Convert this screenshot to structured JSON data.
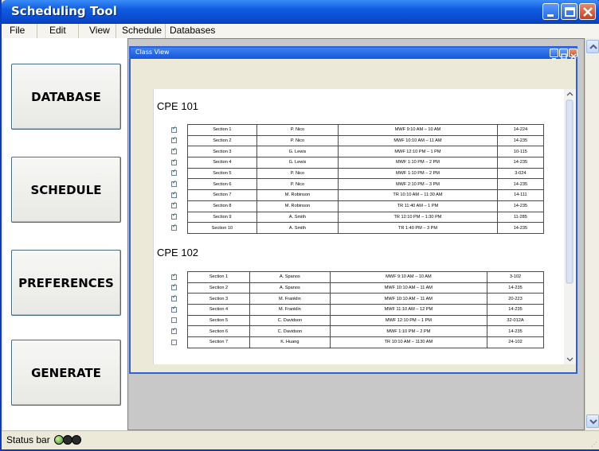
{
  "window": {
    "title": "Scheduling Tool"
  },
  "menu": [
    "File",
    "Edit",
    "View",
    "Schedule",
    "Databases"
  ],
  "left_buttons": [
    "DATABASE",
    "SCHEDULE",
    "PREFERENCES",
    "GENERATE"
  ],
  "status": {
    "text": "Status bar"
  },
  "class_view": {
    "title": "Class View",
    "courses": [
      {
        "name": "CPE 101",
        "rows": [
          {
            "checked": true,
            "section": "Section 1",
            "instructor": "P. Nico",
            "time": "MWF 9:10 AM – 10 AM",
            "room": "14-224"
          },
          {
            "checked": true,
            "section": "Section 2",
            "instructor": "P. Nico",
            "time": "MWF 10:10 AM – 11 AM",
            "room": "14-235"
          },
          {
            "checked": true,
            "section": "Section 3",
            "instructor": "G. Lewis",
            "time": "MWF 12:10 PM – 1 PM",
            "room": "10-115"
          },
          {
            "checked": true,
            "section": "Section 4",
            "instructor": "G. Lewis",
            "time": "MWF 1:10 PM – 2 PM",
            "room": "14-235"
          },
          {
            "checked": true,
            "section": "Section 5",
            "instructor": "P. Nico",
            "time": "MWF 1:10 PM – 2 PM",
            "room": "3-024"
          },
          {
            "checked": true,
            "section": "Section 6",
            "instructor": "P. Nico",
            "time": "MWF 2:10 PM – 3 PM",
            "room": "14-235"
          },
          {
            "checked": true,
            "section": "Section 7",
            "instructor": "M. Robinson",
            "time": "TR 10:10 AM – 11:30 AM",
            "room": "14-111"
          },
          {
            "checked": true,
            "section": "Section 8",
            "instructor": "M. Robinson",
            "time": "TR 11:40 AM – 1 PM",
            "room": "14-235"
          },
          {
            "checked": true,
            "section": "Section 9",
            "instructor": "A. Smith",
            "time": "TR 12:10 PM – 1:30 PM",
            "room": "11-285"
          },
          {
            "checked": true,
            "section": "Section 10",
            "instructor": "A. Smith",
            "time": "TR 1:40 PM – 3 PM",
            "room": "14-235"
          }
        ]
      },
      {
        "name": "CPE 102",
        "rows": [
          {
            "checked": true,
            "section": "Section 1",
            "instructor": "A. Spanos",
            "time": "MWF 9:10 AM – 10 AM",
            "room": "3-102"
          },
          {
            "checked": true,
            "section": "Section 2",
            "instructor": "A. Spanos",
            "time": "MWF 10:10 AM – 11 AM",
            "room": "14-235"
          },
          {
            "checked": true,
            "section": "Section 3",
            "instructor": "M. Franklin",
            "time": "MWF 10:10 AM – 11 AM",
            "room": "20-223"
          },
          {
            "checked": true,
            "section": "Section 4",
            "instructor": "M. Franklin",
            "time": "MWF 11:10 AM – 12 PM",
            "room": "14-235"
          },
          {
            "checked": false,
            "section": "Section 5",
            "instructor": "C. Davidson",
            "time": "MWF 12:10 PM – 1 PM",
            "room": "32-012A"
          },
          {
            "checked": true,
            "section": "Section 6",
            "instructor": "C. Davidson",
            "time": "MWF 1:10 PM – 2 PM",
            "room": "14-235"
          },
          {
            "checked": false,
            "section": "Section 7",
            "instructor": "K. Huang",
            "time": "TR 10:10 AM – 1130 AM",
            "room": "24-102"
          }
        ]
      }
    ]
  }
}
